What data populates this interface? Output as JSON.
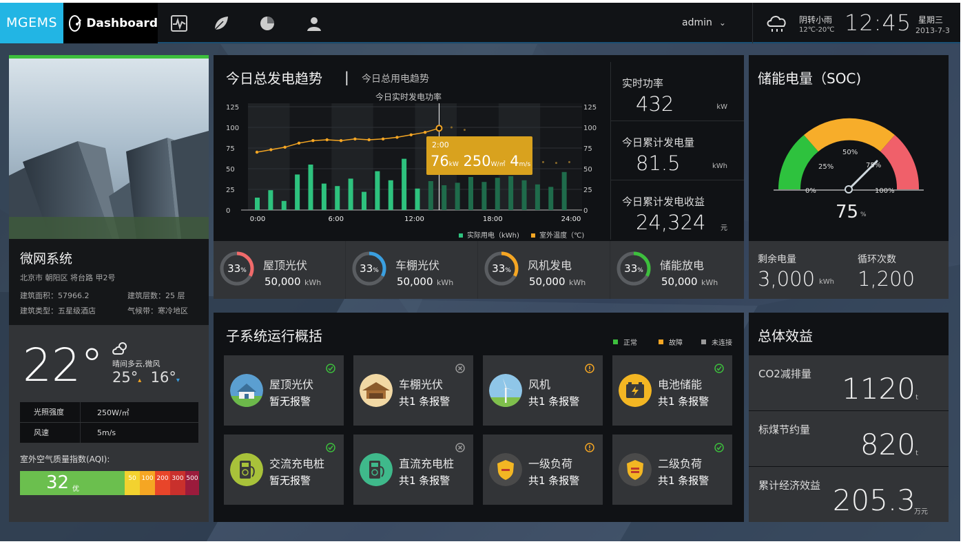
{
  "colors": {
    "brand": "#22b5e4",
    "green": "#2ec27e",
    "orange": "#f5a623",
    "ok": "#3dbf3d",
    "fault": "#f5a623",
    "offline": "#9a9a9a"
  },
  "topbar": {
    "brand": "MGEMS",
    "dashboard_label": "Dashboard",
    "nav_icons": [
      "pulse-icon",
      "leaf-icon",
      "pie-icon",
      "user-icon"
    ],
    "user": "admin",
    "weather_desc": "阴转小雨",
    "weather_range": "12℃-20℃",
    "time": "12:45",
    "weekday": "星期三",
    "date": "2013-7-3"
  },
  "site": {
    "title": "微网系统",
    "address": "北京市 朝阳区 将台路 甲2号",
    "area": "建筑面积：57966.2",
    "floors": "建筑层数：25 层",
    "type": "建筑类型：五星级酒店",
    "climate": "气候带：寒冷地区"
  },
  "weather": {
    "temp": "22°",
    "desc": "晴间多云,微风",
    "high": "25°",
    "low": "16°",
    "rows": [
      {
        "k": "光照强度",
        "v": "250W/㎡"
      },
      {
        "k": "风速",
        "v": "5m/s"
      }
    ],
    "aqi_title": "室外空气质量指数(AQI):",
    "aqi_value": "32",
    "aqi_level": "优",
    "aqi_scale": [
      "50",
      "100",
      "200",
      "300",
      "500"
    ]
  },
  "trend": {
    "title": "今日总发电趋势",
    "separator": "|",
    "subtitle": "今日总用电趋势",
    "chart_title": "今日实时发电功率",
    "tooltip_time": "2:00",
    "tooltip_power": "76",
    "tooltip_power_unit": "kW",
    "tooltip_irr": "250",
    "tooltip_irr_unit": "W/㎡",
    "tooltip_wind": "4",
    "tooltip_wind_unit": "m/s"
  },
  "chart_data": {
    "type": "bar",
    "title": "今日实时发电功率",
    "x_ticks": [
      "0:00",
      "6:00",
      "12:00",
      "18:00",
      "24:00"
    ],
    "y_ticks": [
      "125",
      "100",
      "75",
      "50",
      "25",
      "0"
    ],
    "ylim": [
      0,
      125
    ],
    "series": [
      {
        "name": "实际用电（kWh)",
        "type": "bar",
        "values": [
          15,
          24,
          11,
          43,
          55,
          32,
          29,
          38,
          22,
          47,
          36,
          62,
          26,
          35,
          30,
          33,
          40,
          34,
          39,
          41,
          36,
          31,
          28,
          46
        ]
      },
      {
        "name": "室外温度（℃)",
        "type": "line",
        "values": [
          70,
          73,
          76,
          81,
          84,
          85,
          84,
          86,
          85,
          86,
          88,
          91,
          94,
          99
        ]
      }
    ],
    "series_faded_from_index": 13,
    "temp_dots_future": [
      100,
      97,
      86,
      74,
      74,
      72,
      69,
      58,
      57,
      58
    ]
  },
  "metrics": [
    {
      "label": "实时功率",
      "value": "432",
      "unit": "kW"
    },
    {
      "label": "今日累计发电量",
      "value": "81.5",
      "unit": "kWh"
    },
    {
      "label": "今日累计发电收益",
      "value": "24,324",
      "unit": "元"
    }
  ],
  "gauges": [
    {
      "pct": "33",
      "pct_sign": "%",
      "name": "屋顶光伏",
      "value": "50,000",
      "unit": "kWh",
      "color": "#f06a6a",
      "fraction": 0.33
    },
    {
      "pct": "33",
      "pct_sign": "%",
      "name": "车棚光伏",
      "value": "50,000",
      "unit": "kWh",
      "color": "#3a9fe0",
      "fraction": 0.33
    },
    {
      "pct": "33",
      "pct_sign": "%",
      "name": "风机发电",
      "value": "50,000",
      "unit": "kWh",
      "color": "#f5a623",
      "fraction": 0.33
    },
    {
      "pct": "33",
      "pct_sign": "%",
      "name": "储能放电",
      "value": "50,000",
      "unit": "kWh",
      "color": "#3dbf3d",
      "fraction": 0.33
    }
  ],
  "soc": {
    "title": "储能电量（SOC)",
    "ticks": [
      "0%",
      "25%",
      "50%",
      "75%",
      "100%"
    ],
    "value": "75",
    "value_unit": "%",
    "level": 0.75,
    "remain_label": "剩余电量",
    "remain_value": "3,000",
    "remain_unit": "kWh",
    "cycles_label": "循环次数",
    "cycles_value": "1,200"
  },
  "subsystems": {
    "title": "子系统运行概括",
    "legend": [
      {
        "label": "正常",
        "color": "#3dbf3d"
      },
      {
        "label": "故障",
        "color": "#f5a623"
      },
      {
        "label": "未连接",
        "color": "#9a9a9a"
      }
    ],
    "cards": [
      {
        "name": "屋顶光伏",
        "status": "暂无报警",
        "state": "ok",
        "icon": "house-solar-icon"
      },
      {
        "name": "车棚光伏",
        "status": "共1 条报警",
        "state": "offline",
        "icon": "carport-icon"
      },
      {
        "name": "风机",
        "status": "共1 条报警",
        "state": "fault",
        "icon": "wind-turbine-icon"
      },
      {
        "name": "电池储能",
        "status": "共1 条报警",
        "state": "ok",
        "icon": "battery-icon"
      },
      {
        "name": "交流充电桩",
        "status": "暂无报警",
        "state": "ok",
        "icon": "ac-charger-icon"
      },
      {
        "name": "直流充电桩",
        "status": "共1 条报警",
        "state": "offline",
        "icon": "dc-charger-icon"
      },
      {
        "name": "一级负荷",
        "status": "共1 条报警",
        "state": "fault",
        "icon": "shield-level1-icon"
      },
      {
        "name": "二级负荷",
        "status": "共1 条报警",
        "state": "ok",
        "icon": "shield-level2-icon"
      }
    ]
  },
  "benefits": {
    "title": "总体效益",
    "rows": [
      {
        "label": "CO2减排量",
        "value": "1120",
        "unit": "t"
      },
      {
        "label": "标煤节约量",
        "value": "820",
        "unit": "t"
      },
      {
        "label": "累计经济效益",
        "value": "205.3",
        "unit": "万元"
      }
    ]
  }
}
